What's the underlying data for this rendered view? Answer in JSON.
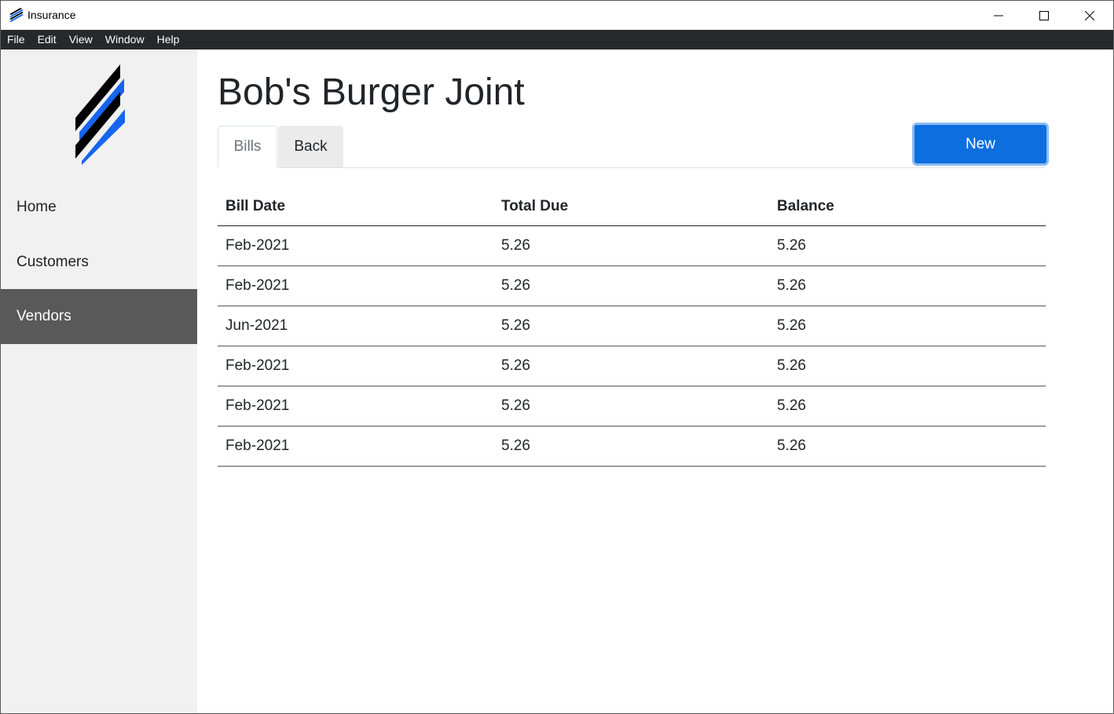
{
  "window": {
    "title": "Insurance"
  },
  "menu": {
    "items": [
      "File",
      "Edit",
      "View",
      "Window",
      "Help"
    ]
  },
  "sidebar": {
    "items": [
      {
        "label": "Home"
      },
      {
        "label": "Customers"
      },
      {
        "label": "Vendors",
        "active": true
      }
    ]
  },
  "main": {
    "title": "Bob's Burger Joint",
    "tabs": [
      {
        "label": "Bills",
        "active": true
      },
      {
        "label": "Back"
      }
    ],
    "new_button_label": "New"
  },
  "table": {
    "headers": [
      "Bill Date",
      "Total Due",
      "Balance"
    ],
    "rows": [
      [
        "Feb-2021",
        "5.26",
        "5.26"
      ],
      [
        "Feb-2021",
        "5.26",
        "5.26"
      ],
      [
        "Jun-2021",
        "5.26",
        "5.26"
      ],
      [
        "Feb-2021",
        "5.26",
        "5.26"
      ],
      [
        "Feb-2021",
        "5.26",
        "5.26"
      ],
      [
        "Feb-2021",
        "5.26",
        "5.26"
      ]
    ]
  },
  "colors": {
    "menubar": "#27282b",
    "sidebar": "#f1f1f1",
    "sidebar_active": "#595959",
    "accent": "#0d6ee0",
    "logo_blue": "#1565f0",
    "logo_black": "#000000"
  },
  "icons": {
    "app": "stripes-logo-icon",
    "minimize": "minimize-icon",
    "maximize": "maximize-icon",
    "close": "close-icon"
  }
}
